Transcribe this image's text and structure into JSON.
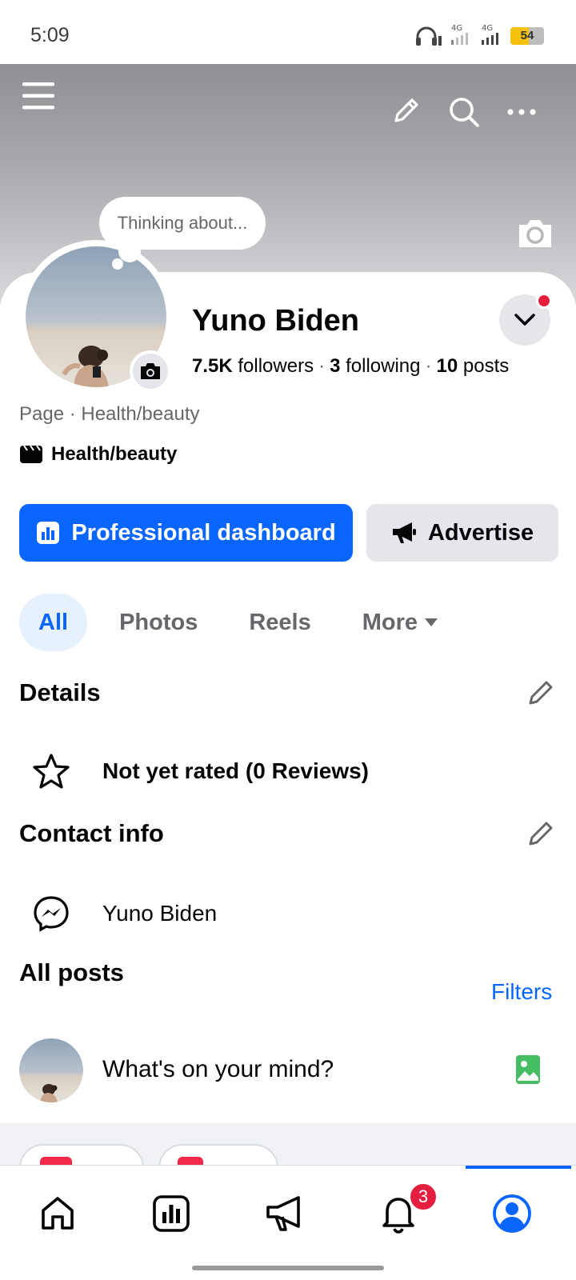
{
  "status_bar": {
    "time": "5:09",
    "network_1": "4G",
    "network_2": "4G",
    "battery_percent": "54",
    "battery_level": 0.54,
    "battery_color": "#f4c20d"
  },
  "header": {
    "icons": [
      "menu-icon",
      "edit-icon",
      "search-icon",
      "more-icon",
      "camera-icon"
    ]
  },
  "profile": {
    "thought_bubble": "Thinking about...",
    "name": "Yuno Biden",
    "followers_count": "7.5K",
    "followers_label": "followers",
    "following_count": "3",
    "following_label": "following",
    "posts_count": "10",
    "posts_label": "posts",
    "page_category": "Page · Health/beauty",
    "category_label": "Health/beauty",
    "notification_dot_color": "#e41e3f"
  },
  "actions": {
    "dashboard_label": "Professional dashboard",
    "advertise_label": "Advertise",
    "primary_color": "#0866ff"
  },
  "tabs": {
    "all": "All",
    "photos": "Photos",
    "reels": "Reels",
    "more": "More"
  },
  "details": {
    "title": "Details",
    "rating_text": "Not yet rated (0 Reviews)"
  },
  "contact": {
    "title": "Contact info",
    "messenger_name": "Yuno Biden"
  },
  "posts": {
    "title": "All posts",
    "filters_label": "Filters",
    "composer_placeholder": "What's on your mind?"
  },
  "bottom_nav": {
    "items": [
      "home-icon",
      "dashboard-icon",
      "megaphone-icon",
      "bell-icon",
      "profile-icon"
    ],
    "notification_count": "3",
    "active": "profile-icon"
  }
}
